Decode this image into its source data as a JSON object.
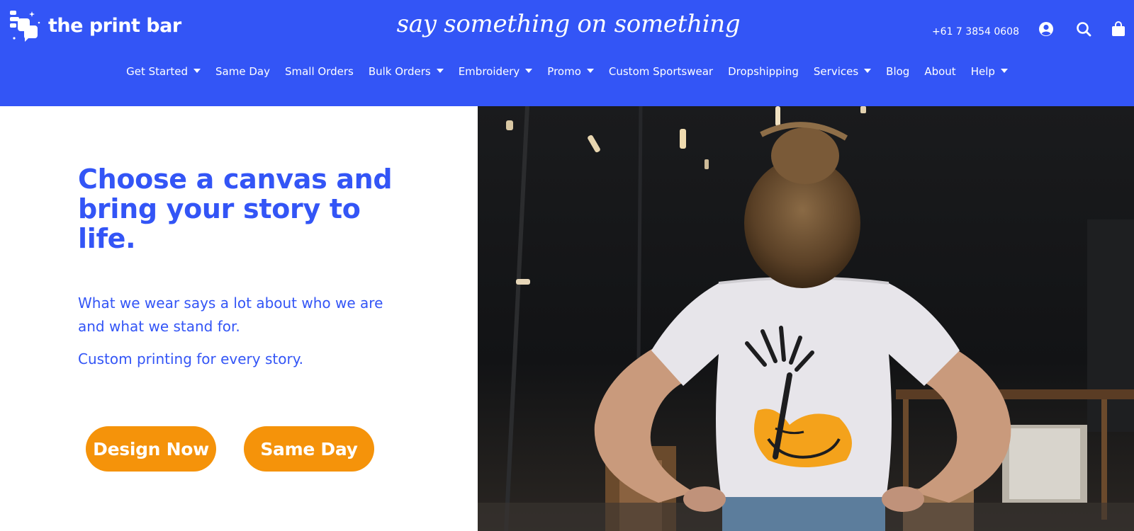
{
  "brand": {
    "name": "the print bar",
    "logo_icon": "speech-bubbles-logo"
  },
  "tagline": "say something on something",
  "header": {
    "phone": "+61 7 3854 0608",
    "icons": {
      "account": "user-circle-icon",
      "search": "search-icon",
      "cart": "shopping-bag-icon"
    }
  },
  "nav": {
    "items": [
      {
        "label": "Get Started",
        "dropdown": true
      },
      {
        "label": "Same Day",
        "dropdown": false
      },
      {
        "label": "Small Orders",
        "dropdown": false
      },
      {
        "label": "Bulk Orders",
        "dropdown": true
      },
      {
        "label": "Embroidery",
        "dropdown": true
      },
      {
        "label": "Promo",
        "dropdown": true
      },
      {
        "label": "Custom Sportswear",
        "dropdown": false
      },
      {
        "label": "Dropshipping",
        "dropdown": false
      },
      {
        "label": "Services",
        "dropdown": true
      },
      {
        "label": "Blog",
        "dropdown": false
      },
      {
        "label": "About",
        "dropdown": false
      },
      {
        "label": "Help",
        "dropdown": true
      }
    ]
  },
  "hero": {
    "headline": "Choose a canvas and bring your story to life.",
    "paragraph1": "What we wear says a lot about who we are and what we stand for.",
    "paragraph2": "Custom printing for every story.",
    "buttons": {
      "design": "Design Now",
      "same_day": "Same Day"
    },
    "image": "woman-in-printed-tshirt-photo"
  },
  "colors": {
    "brand_blue": "#3355f6",
    "accent_orange": "#f5930a",
    "white": "#ffffff"
  }
}
